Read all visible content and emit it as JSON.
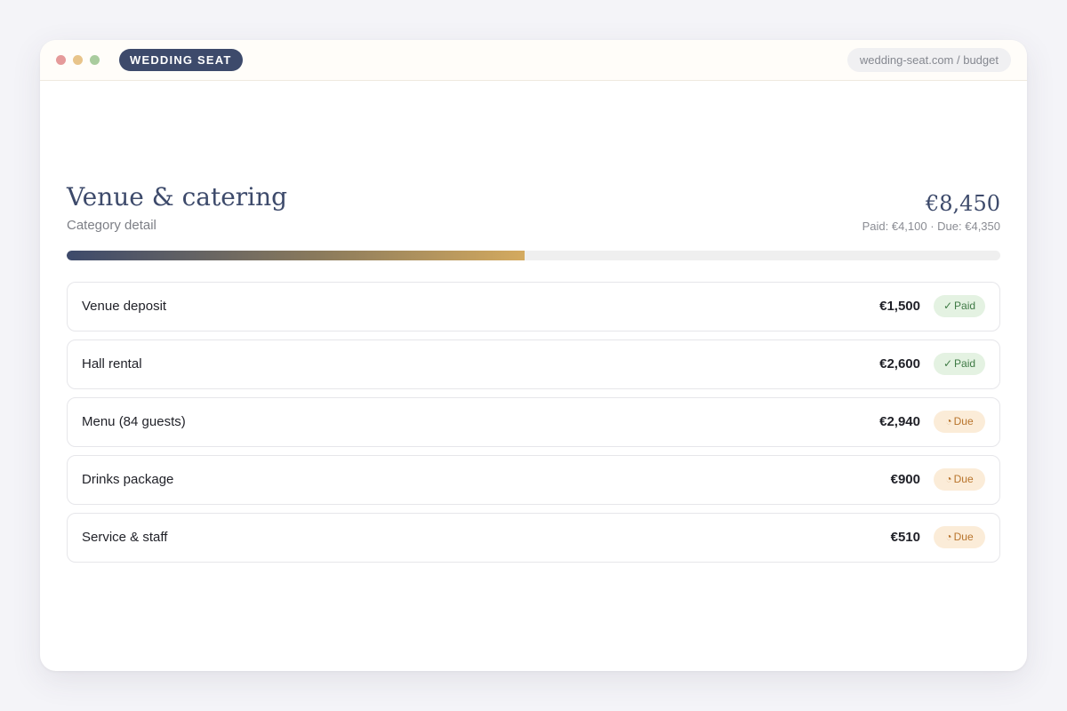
{
  "window": {
    "brand": "WEDDING SEAT",
    "url": "wedding-seat.com / budget"
  },
  "category": {
    "title": "Venue & catering",
    "subtitle": "Category detail",
    "total": "€8,450",
    "paid_due": "Paid: €4,100 · Due: €4,350",
    "paid_fraction": 0.49
  },
  "items": [
    {
      "name": "Venue deposit",
      "amount": "€1,500",
      "status": "Paid",
      "status_type": "paid",
      "icon": "check-icon",
      "icon_glyph": "✓"
    },
    {
      "name": "Hall rental",
      "amount": "€2,600",
      "status": "Paid",
      "status_type": "paid",
      "icon": "check-icon",
      "icon_glyph": "✓"
    },
    {
      "name": "Menu (84 guests)",
      "amount": "€2,940",
      "status": "Due",
      "status_type": "due",
      "icon": "clock-icon",
      "icon_glyph": "◔"
    },
    {
      "name": "Drinks package",
      "amount": "€900",
      "status": "Due",
      "status_type": "due",
      "icon": "clock-icon",
      "icon_glyph": "◔"
    },
    {
      "name": "Service & staff",
      "amount": "€510",
      "status": "Due",
      "status_type": "due",
      "icon": "clock-icon",
      "icon_glyph": "◔"
    }
  ],
  "colors": {
    "brand": "#3d4a6b",
    "paid": "#3f7a45",
    "due": "#b8742c",
    "accent": "#d4aa5f"
  }
}
